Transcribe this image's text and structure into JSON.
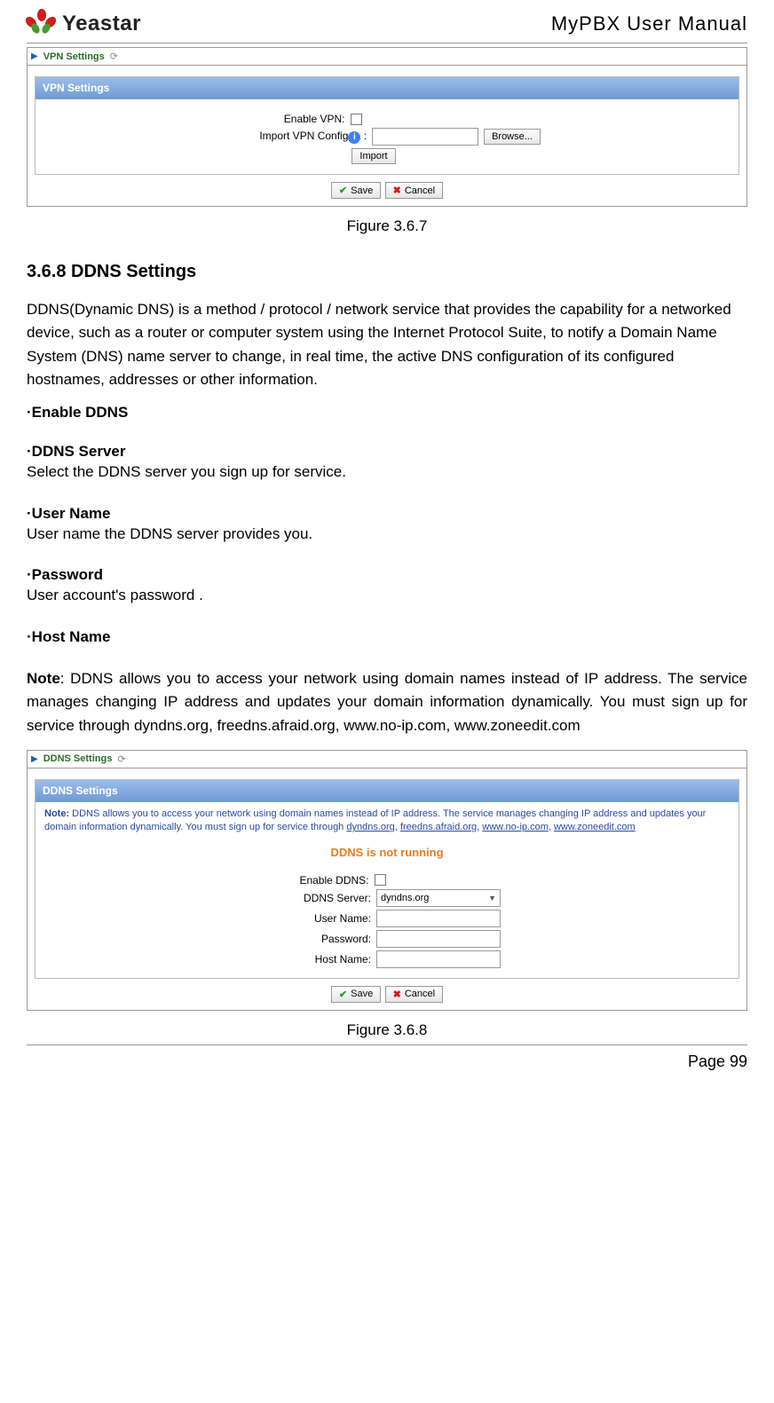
{
  "header": {
    "brand": "Yeastar",
    "doc_title": "MyPBX User Manual"
  },
  "fig1": {
    "breadcrumb": "VPN Settings",
    "panel_title": "VPN Settings",
    "enable_label": "Enable VPN:",
    "import_label": "Import VPN Config",
    "browse": "Browse...",
    "import_btn": "Import",
    "save": "Save",
    "cancel": "Cancel",
    "caption": "Figure 3.6.7"
  },
  "section": {
    "heading": "3.6.8 DDNS Settings",
    "intro": "DDNS(Dynamic DNS) is a method / protocol / network service that provides the capability for a networked device, such as a router or computer system using the Internet Protocol Suite, to notify a Domain Name System (DNS) name server to change, in real time, the active DNS configuration of its configured hostnames, addresses or other information.",
    "t1": "·Enable DDNS",
    "t2": "·DDNS Server",
    "d2": "Select the DDNS server you sign up for service.",
    "t3": "·User Name",
    "d3": "User name the DDNS server provides you.",
    "t4": "·Password",
    "d4": "User account's password .",
    "t5": "·Host Name",
    "note_label": "Note",
    "note_text": ": DDNS allows you to access your network using domain names instead of IP address. The service manages changing IP address and updates your domain information dynamically. You must sign up for service through dyndns.org, freedns.afraid.org, www.no-ip.com, www.zoneedit.com"
  },
  "fig2": {
    "breadcrumb": "DDNS Settings",
    "panel_title": "DDNS Settings",
    "note_prefix": "Note:",
    "note_body": " DDNS allows you to access your network using domain names instead of IP address. The service manages changing IP address and updates your domain information dynamically. You must sign up for service through ",
    "link1": "dyndns.org",
    "link2": "freedns.afraid.org",
    "link3": "www.no-ip.com",
    "link4": "www.zoneedit.com",
    "status": "DDNS is not running",
    "enable_label": "Enable DDNS:",
    "server_label": "DDNS Server:",
    "server_value": "dyndns.org",
    "user_label": "User Name:",
    "pass_label": "Password:",
    "host_label": "Host Name:",
    "save": "Save",
    "cancel": "Cancel",
    "caption": "Figure 3.6.8"
  },
  "footer": {
    "page": "Page 99"
  }
}
